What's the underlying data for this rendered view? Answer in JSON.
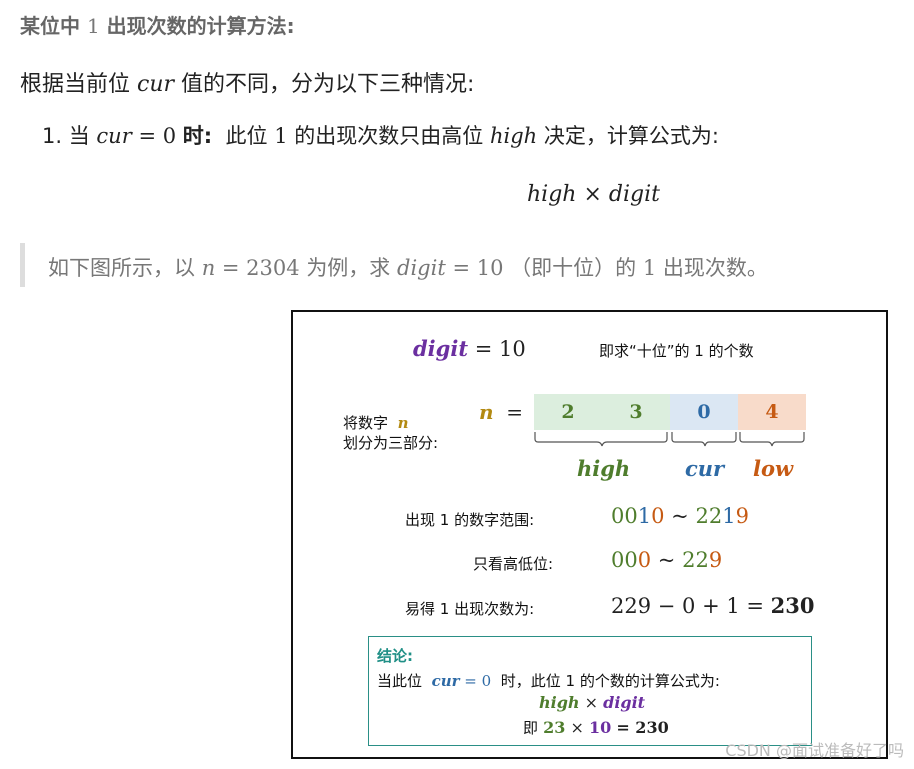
{
  "article": {
    "heading_prefix": "某位中",
    "heading_one": "1",
    "heading_suffix": "出现次数的计算方法:",
    "intro_prefix": "根据当前位",
    "intro_var": "cur",
    "intro_suffix": "值的不同，分为以下三种情况:",
    "item_number": "1.",
    "item_when": "当",
    "item_cond_var": "cur",
    "item_cond_eq": "= 0",
    "item_bold": "时:",
    "item_text_a": "此位",
    "item_text_one": "1",
    "item_text_b": "的出现次数只由高位",
    "item_high": "high",
    "item_text_c": "决定，计算公式为:",
    "formula_high": "high",
    "formula_times": "×",
    "formula_digit": "digit",
    "quote_a": "如下图所示，以",
    "quote_n": "n",
    "quote_eq": "= 2304",
    "quote_b": "为例，求",
    "quote_digit": "digit",
    "quote_eq2": "= 10",
    "quote_c": "（即十位）的",
    "quote_one": "1",
    "quote_d": "出现次数。"
  },
  "figure": {
    "digit_var": "digit",
    "digit_eq": "= 10",
    "digit_note": "即求“十位”的  1  的个数",
    "split_label_1": "将数字",
    "split_label_n": "n",
    "split_label_2": "划分为三部分:",
    "n_var": "n",
    "n_eq": "=",
    "digits": [
      "2",
      "3",
      "0",
      "4"
    ],
    "part_high": "high",
    "part_cur": "cur",
    "part_low": "low",
    "range_label": "出现  1  的数字范围:",
    "range_from_a": "00",
    "range_from_b": "1",
    "range_from_c": "0",
    "range_tilde": "~",
    "range_to_a": "22",
    "range_to_b": "1",
    "range_to_c": "9",
    "highlow_label": "只看高低位:",
    "hl_from_a": "00",
    "hl_from_b": "0",
    "hl_tilde": "~",
    "hl_to_a": "22",
    "hl_to_b": "9",
    "count_label": "易得  1  出现次数为:",
    "count_expr": "229 − 0 + 1 =",
    "count_result": "230",
    "conclusion_title": "结论:",
    "conclusion_a": "当此位",
    "conclusion_cur": "cur",
    "conclusion_eq": "= 0",
    "conclusion_b": "时，此位  1  的个数的计算公式为:",
    "conclusion_high": "high",
    "conclusion_times": "×",
    "conclusion_digit": "digit",
    "conclusion_ji": "即",
    "conclusion_23": "23",
    "conclusion_times2": "×",
    "conclusion_10": "10",
    "conclusion_eq2": "= 230"
  },
  "watermark": "CSDN @面试准备好了吗",
  "colors": {
    "purple": "#6b2fa0",
    "green": "#4f7d2d",
    "blue": "#2e6aa5",
    "orange": "#c65a13",
    "gold": "#b38a12",
    "teal": "#1f8f86"
  }
}
